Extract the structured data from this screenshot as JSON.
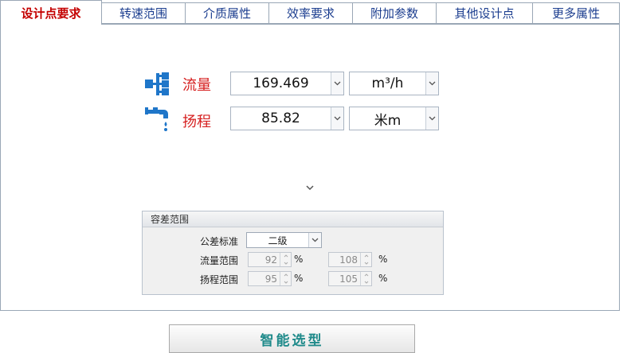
{
  "tabs": [
    {
      "label": "设计点要求",
      "active": true
    },
    {
      "label": "转速范围"
    },
    {
      "label": "介质属性"
    },
    {
      "label": "效率要求"
    },
    {
      "label": "附加参数"
    },
    {
      "label": "其他设计点"
    },
    {
      "label": "更多属性"
    }
  ],
  "flow": {
    "label": "流量",
    "value": "169.469",
    "unit": "m³/h",
    "icon": "flow-manifold-icon"
  },
  "head": {
    "label": "扬程",
    "value": "85.82",
    "unit": "米m",
    "icon": "faucet-icon"
  },
  "tolerance": {
    "title": "容差范围",
    "standard_label": "公差标准",
    "standard_value": "二级",
    "flow_range_label": "流量范围",
    "flow_min": "92",
    "flow_max": "108",
    "head_range_label": "扬程范围",
    "head_min": "95",
    "head_max": "105",
    "percent": "%"
  },
  "actions": {
    "smart_select": "智能选型"
  },
  "colors": {
    "tab_active": "#c40000",
    "tab_text": "#1b3d8f",
    "label_red": "#d62020",
    "icon_blue": "#1f76c9",
    "button_text": "#1f8a8a"
  }
}
